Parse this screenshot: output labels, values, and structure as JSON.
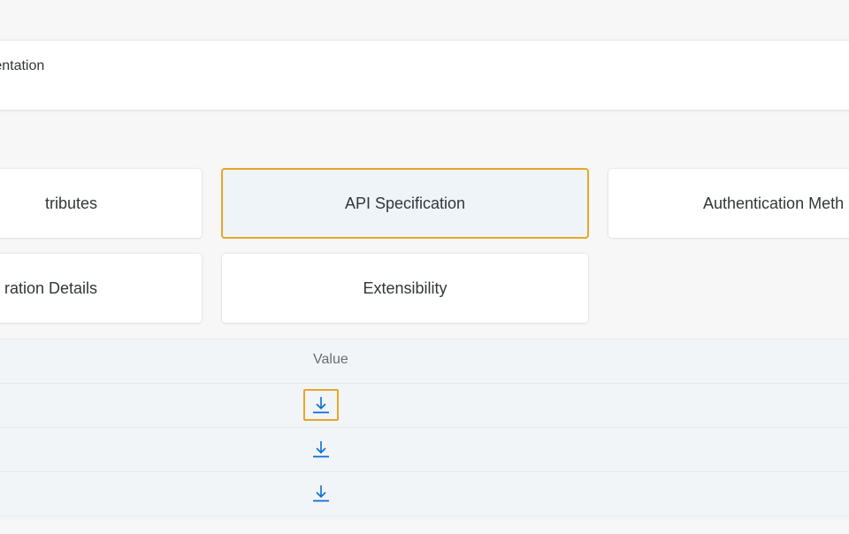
{
  "header": {
    "title_fragment": "mentation"
  },
  "tiles": {
    "attributes": "tributes",
    "api_specification": "API Specification",
    "authentication_methods": "Authentication Meth",
    "configuration_details": "ration Details",
    "extensibility": "Extensibility",
    "selected": "API Specification"
  },
  "table": {
    "value_header": "Value",
    "rows": [
      {
        "value_icon": "download-icon",
        "focused": true
      },
      {
        "value_icon": "download-icon",
        "focused": false
      },
      {
        "value_icon": "download-icon",
        "focused": false
      }
    ]
  },
  "colors": {
    "accent_focus": "#e9a527",
    "link_blue": "#0a6ed1",
    "selected_tile_bg": "#eff4f9",
    "table_bg": "#f2f5f8",
    "page_bg": "#f7f7f7"
  }
}
